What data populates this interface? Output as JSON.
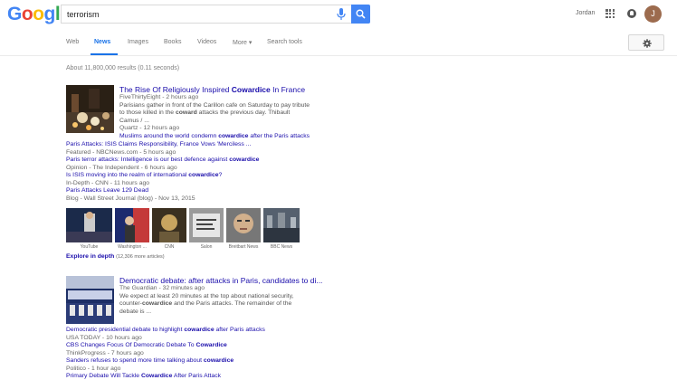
{
  "header": {
    "logo_letters": [
      "G",
      "o",
      "o",
      "g",
      "l",
      "e"
    ],
    "logo_colors": [
      "#4285f4",
      "#ea4335",
      "#fbbc05",
      "#4285f4",
      "#34a853",
      "#ea4335"
    ],
    "search_value": "terrorism",
    "user_name": "Jordan",
    "avatar_letter": "J"
  },
  "tabs": [
    "Web",
    "News",
    "Images",
    "Books",
    "Videos",
    "More ▾",
    "Search tools"
  ],
  "active_tab": "News",
  "result_stats": "About 11,800,000 results (0.11 seconds)",
  "story1": {
    "title_pre": "The Rise Of Religiously Inspired ",
    "title_bold": "Cowardice",
    "title_post": " In France",
    "source": "FiveThirtyEight - 2 hours ago",
    "snippet_1": "Parisians gather in front of the Carillon cafe on Saturday to pay tribute",
    "snippet_2_pre": "to those killed in the ",
    "snippet_2_bold": "coward",
    "snippet_2_post": " attacks the previous day. Thibault",
    "snippet_3": "Camus / ...",
    "rel1_source": "Quartz - 12 hours ago",
    "rel1_title_pre": "Muslims around the world condemn ",
    "rel1_title_bold": "cowardice",
    "rel1_title_post": " after the Paris attacks",
    "rel2_title": "Paris Attacks: ISIS Claims Responsibility, France Vows 'Merciless ...",
    "rel2_source": "Featured - NBCNews.com - 5 hours ago",
    "rel3_title_pre": "Paris terror attacks: Intelligence is our best defence against ",
    "rel3_title_bold": "cowardice",
    "rel3_source": "Opinion - The Independent - 6 hours ago",
    "rel4_title_pre": "Is ISIS moving into the realm of international ",
    "rel4_title_bold": "cowardice",
    "rel4_title_post": "?",
    "rel4_source": "In-Depth - CNN - 11 hours ago",
    "rel5_title": "Paris Attacks Leave 129 Dead",
    "rel5_source": "Blog - Wall Street Journal (blog) - Nov 13, 2015",
    "strip_captions": [
      "YouTube",
      "Washington ...",
      "CNN",
      "Salon",
      "Breitbart News",
      "BBC News"
    ],
    "explore_label": "Explore in depth",
    "explore_count": "(12,306 more articles)"
  },
  "story2": {
    "title": "Democratic debate: after attacks in Paris, candidates to di...",
    "source": "The Guardian - 32 minutes ago",
    "snippet_1": "We expect at least 20 minutes at the top about national security,",
    "snippet_2_pre": "counter-",
    "snippet_2_bold": "cowardice",
    "snippet_2_post": " and the Paris attacks. The remainder of the",
    "snippet_3": "debate is ...",
    "rel1_title_pre": "Democratic presidential debate to highlight ",
    "rel1_title_bold": "cowardice",
    "rel1_title_post": " after Paris attacks",
    "rel1_source": "USA TODAY - 10 hours ago",
    "rel2_title_pre": "CBS Changes Focus Of Democratic Debate To ",
    "rel2_title_bold": "Cowardice",
    "rel2_source": "ThinkProgress - 7 hours ago",
    "rel3_title_pre": "Sanders refuses to spend more time talking about ",
    "rel3_title_bold": "cowardice",
    "rel3_source": "Politico - 1 hour ago",
    "rel4_title_pre": "Primary Debate Will Tackle ",
    "rel4_title_bold": "Cowardice",
    "rel4_title_post": " After Paris Attack"
  }
}
